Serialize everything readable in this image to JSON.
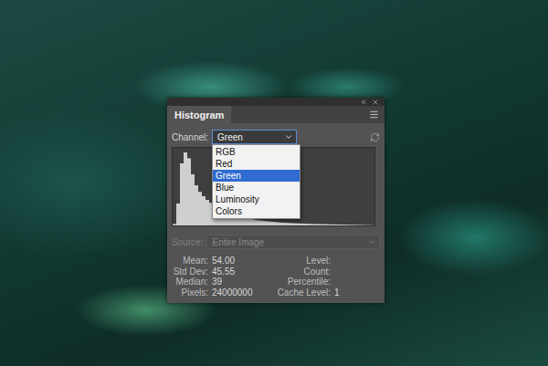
{
  "tabs": [
    {
      "label": "Histogram",
      "selected": true
    }
  ],
  "channel": {
    "label": "Channel:",
    "value": "Green",
    "expanded": true,
    "options": [
      {
        "label": "RGB",
        "selected": false
      },
      {
        "label": "Red",
        "selected": false
      },
      {
        "label": "Green",
        "selected": true
      },
      {
        "label": "Blue",
        "selected": false
      },
      {
        "label": "Luminosity",
        "selected": false
      },
      {
        "label": "Colors",
        "selected": false
      }
    ]
  },
  "histogram": {
    "values": [
      2,
      30,
      85,
      100,
      92,
      70,
      55,
      46,
      40,
      35,
      31,
      28,
      25,
      22,
      20,
      18,
      16,
      14,
      12,
      11,
      10,
      9,
      8,
      7,
      6.5,
      6,
      5.5,
      5,
      4.5,
      4,
      3.8,
      3.5,
      3.2,
      3,
      2.8,
      2.6,
      2.4,
      2.2,
      2,
      1.9,
      1.8,
      1.7,
      1.6,
      1.5,
      1.4,
      1.3,
      1.2,
      1.1,
      1,
      0.9,
      0.8,
      0.7,
      0.6,
      0.5,
      0.4
    ]
  },
  "source": {
    "label": "Source:",
    "value": "Entire Image",
    "disabled": true
  },
  "stats": {
    "left": [
      {
        "label": "Mean:",
        "value": "54.00"
      },
      {
        "label": "Std Dev:",
        "value": "45.55"
      },
      {
        "label": "Median:",
        "value": "39"
      },
      {
        "label": "Pixels:",
        "value": "24000000"
      }
    ],
    "right": [
      {
        "label": "Level:"
      },
      {
        "label": "Count:"
      },
      {
        "label": "Percentile:"
      },
      {
        "label": "Cache Level:",
        "value": "1"
      }
    ]
  }
}
